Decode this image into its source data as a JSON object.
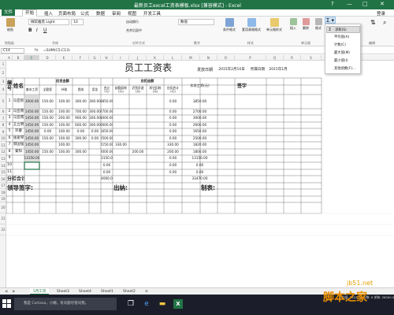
{
  "window": {
    "title": "最新员工excel工资表模板.xlsx [兼容模式] - Excel",
    "controls": [
      "?",
      "—",
      "□",
      "✕"
    ]
  },
  "menu": {
    "items": [
      "文件",
      "开始",
      "插入",
      "页面布局",
      "公式",
      "数据",
      "审阅",
      "视图",
      "开发工具"
    ],
    "active": "开始",
    "signin": "登录"
  },
  "ribbon": {
    "paste_label": "粘贴",
    "font_name": "微软雅黑 Light",
    "font_size": "10",
    "wrap_label": "自动换行",
    "merge_label": "合并后居中",
    "number_format": "数值",
    "cond_label": "条件格式",
    "table_label": "套用表格格式",
    "cellstyle_label": "单元格样式",
    "insert_label": "插入",
    "delete_label": "删除",
    "format_label": "格式",
    "groups": [
      "剪贴板",
      "字体",
      "对齐方式",
      "数字",
      "样式",
      "单元格",
      "编辑"
    ]
  },
  "autosum_menu": {
    "items": [
      {
        "icon": "Σ",
        "label": "求和(S)",
        "selected": true
      },
      {
        "icon": "",
        "label": "平均值(A)",
        "selected": false
      },
      {
        "icon": "",
        "label": "计数(C)",
        "selected": false
      },
      {
        "icon": "",
        "label": "最大值(M)",
        "selected": false
      },
      {
        "icon": "",
        "label": "最小值(I)",
        "selected": false
      },
      {
        "icon": "",
        "label": "其他函数(F)...",
        "selected": false
      }
    ]
  },
  "formula_bar": {
    "name_box": "C14",
    "fx": "fx",
    "formula": "=SUM(C5:C13)"
  },
  "columns": [
    "A",
    "B",
    "C",
    "D",
    "E",
    "F",
    "G",
    "H",
    "I",
    "J",
    "K",
    "L",
    "M",
    "N",
    "O",
    "P",
    "Q",
    "R",
    "S"
  ],
  "rows": [
    "1",
    "2",
    "3",
    "4",
    "5",
    "6",
    "7",
    "8",
    "9",
    "10",
    "11",
    "12",
    "13",
    "14",
    "15",
    "16",
    "17",
    "18",
    "19",
    "20",
    "21",
    "22"
  ],
  "sheet": {
    "title": "员工工资表",
    "pay_date_label": "发放日期",
    "pay_date": "2015年2月10日",
    "period_label": "所属日期",
    "period": "2015年1月",
    "col_no": "编号",
    "col_name": "姓名",
    "group_pay": "应发金额",
    "group_deduct": "应扣金额",
    "col_real": "实发工资(元)",
    "col_sign": "签字",
    "sub_headers": [
      "基本工资",
      "全勤奖",
      "补助",
      "提成",
      "奖金",
      "合计（元）",
      "缺勤扣款(元)",
      "迟到早退(元)",
      "其它扣款(元)",
      "应扣合计(元)"
    ],
    "rows": [
      {
        "no": "1",
        "name": "马亚新",
        "v": [
          "3000.00",
          "150.00",
          "100.00",
          "300.00",
          "300.00",
          "3850.00",
          "",
          "",
          "",
          "0.00",
          "3850.00"
        ]
      },
      {
        "no": "2",
        "name": "马亚南",
        "v": [
          "1450.00",
          "150.00",
          "100.00",
          "700.00",
          "300.00",
          "2700.00",
          "",
          "",
          "",
          "0.00",
          "2700.00"
        ]
      },
      {
        "no": "3",
        "name": "马亚南",
        "v": [
          "1450.00",
          "150.00",
          "200.00",
          "900.00",
          "300.00",
          "3000.00",
          "",
          "",
          "",
          "0.00",
          "3000.00"
        ]
      },
      {
        "no": "4",
        "name": "王立明",
        "v": [
          "1450.00",
          "150.00",
          "100.00",
          "600.00",
          "300.00",
          "2600.00",
          "",
          "",
          "",
          "0.00",
          "2600.00"
        ]
      },
      {
        "no": "5",
        "name": "邓睿",
        "v": [
          "1450.00",
          "0.00",
          "100.00",
          "0.00",
          "0.00",
          "1650.00",
          "",
          "",
          "",
          "0.00",
          "1650.00"
        ]
      },
      {
        "no": "6",
        "name": "张爱琴",
        "v": [
          "1450.00",
          "150.00",
          "100.00",
          "300.00",
          "0.00",
          "2500.00",
          "",
          "",
          "",
          "0.00",
          "2500.00"
        ]
      },
      {
        "no": "7",
        "name": "郭国强",
        "v": [
          "1450.00",
          "",
          "100.00",
          "",
          "",
          "2150.00",
          "330.00",
          "",
          "",
          "330.00",
          "1820.00"
        ]
      },
      {
        "no": "8",
        "name": "秦阳",
        "v": [
          "1450.00",
          "150.00",
          "100.00",
          "300.00",
          "",
          "2000.00",
          "",
          "200.00",
          "",
          "200.00",
          "1800.00"
        ]
      },
      {
        "no": "9",
        "name": "",
        "v": [
          "13150.00",
          "",
          "",
          "",
          "",
          "13150.00",
          "",
          "",
          "",
          "0.00",
          "13150.00"
        ]
      },
      {
        "no": "10",
        "name": "",
        "v": [
          "",
          "",
          "",
          "",
          "",
          "0.00",
          "",
          "",
          "",
          "0.00",
          "0.00"
        ]
      },
      {
        "no": "11",
        "name": "",
        "v": [
          "",
          "",
          "",
          "",
          "",
          "0.00",
          "",
          "",
          "",
          "0.00",
          "0.00"
        ]
      }
    ],
    "subtotal_label": "分栏合计",
    "subtotal_total": "34000.00",
    "subtotal_real": "33470.00",
    "footer_leader": "领导签字:",
    "footer_cashier": "出纳:",
    "footer_maker": "制表:"
  },
  "tabs": {
    "items": [
      "5月工资",
      "Sheet3",
      "Sheet4",
      "Sheet1",
      "Sheet2"
    ],
    "active": "5月工资",
    "add": "⊕"
  },
  "taskbar": {
    "search_text": "我是 Cortana，小娜。有问题尽管问我。",
    "status": "平均值: 2922.22  计数: 9  求和: 26300.00"
  },
  "watermark": {
    "site": "jb51.net",
    "name": "脚本之家"
  },
  "colors": {
    "excel_green": "#217346",
    "selection": "#c6c6c6",
    "taskbar": "#1b1e2a"
  }
}
